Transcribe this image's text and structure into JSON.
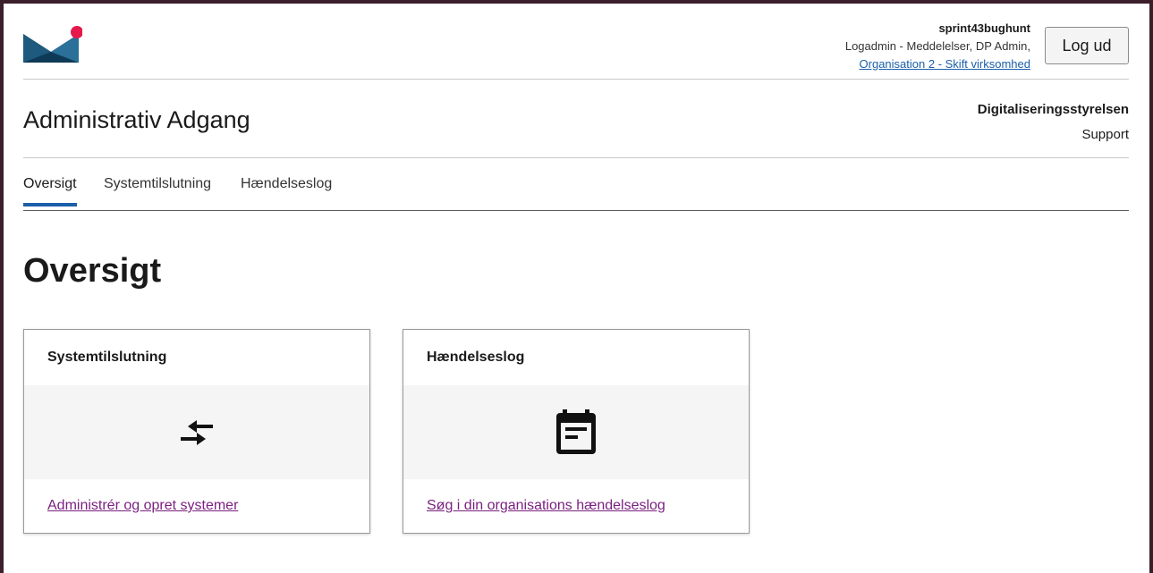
{
  "header": {
    "user_name": "sprint43bughunt",
    "user_roles": "Logadmin - Meddelelser, DP Admin,",
    "org_switch": "Organisation 2 - Skift virksomhed",
    "logout_label": "Log ud"
  },
  "app": {
    "title": "Administrativ Adgang",
    "org_name": "Digitaliseringsstyrelsen",
    "support_label": "Support"
  },
  "tabs": [
    {
      "label": "Oversigt",
      "active": true
    },
    {
      "label": "Systemtilslutning",
      "active": false
    },
    {
      "label": "Hændelseslog",
      "active": false
    }
  ],
  "page": {
    "heading": "Oversigt"
  },
  "cards": [
    {
      "title": "Systemtilslutning",
      "icon": "compare-arrows-icon",
      "link": "Administrér og opret systemer"
    },
    {
      "title": "Hændelseslog",
      "icon": "calendar-event-icon",
      "link": "Søg i din organisations hændelseslog"
    }
  ],
  "colors": {
    "accent": "#1b5fab",
    "visited_link": "#7a2180",
    "logo_dark": "#0e3a57",
    "logo_dot": "#e5194c",
    "frame": "#3b1f2b"
  }
}
